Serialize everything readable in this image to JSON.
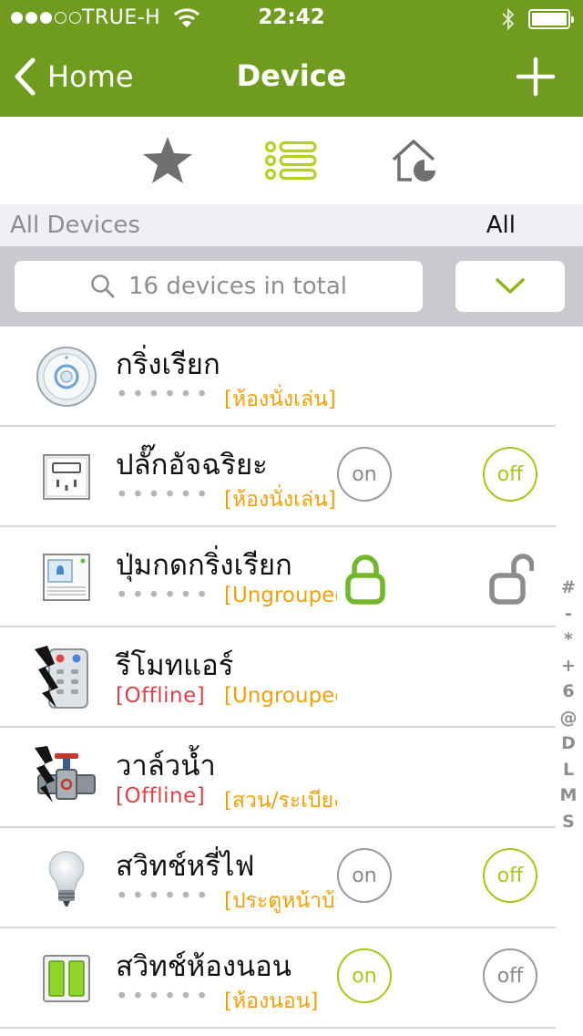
{
  "status_bar": {
    "carrier": "TRUE-H",
    "time": "22:42"
  },
  "nav": {
    "back_label": "Home",
    "title": "Device"
  },
  "tabs": [
    {
      "icon": "star-icon",
      "selected": false
    },
    {
      "icon": "list-icon",
      "selected": true
    },
    {
      "icon": "home-chart-icon",
      "selected": false
    }
  ],
  "section": {
    "title": "All Devices",
    "filter": "All"
  },
  "search": {
    "text": "16 devices  in total"
  },
  "devices": [
    {
      "name": "กริ่งเรียก",
      "status": "••••••",
      "room": "[ห้องนั่งเล่น]",
      "icon": "doorbell-icon"
    },
    {
      "name": "ปลั๊กอัจฉริยะ",
      "status": "••••••",
      "room": "[ห้องนั่งเล่น]",
      "icon": "smart-plug-icon",
      "on_label": "on",
      "off_label": "off"
    },
    {
      "name": "ปุ่มกดกริ่งเรียก",
      "status": "••••••",
      "room": "[Ungrouped]",
      "icon": "bell-button-icon"
    },
    {
      "name": "รีโมทแอร์",
      "status": "[Offline]",
      "room": "[Ungrouped]",
      "icon": "ac-remote-icon"
    },
    {
      "name": "วาล์วน้ำ",
      "status": "[Offline]",
      "room": "[สวน/ระเบียง]",
      "icon": "water-valve-icon"
    },
    {
      "name": "สวิทช์หรี่ไฟ",
      "status": "••••••",
      "room": "[ประตูหน้าบ้าน]",
      "icon": "light-bulb-icon",
      "on_label": "on",
      "off_label": "off"
    },
    {
      "name": "สวิทช์ห้องนอน",
      "status": "••••••",
      "room": "[ห้องนอน]",
      "icon": "wall-switch-icon",
      "on_label": "on",
      "off_label": "off"
    }
  ],
  "index_letters": [
    "#",
    "-",
    "*",
    "+",
    "6",
    "@",
    "D",
    "L",
    "M",
    "S"
  ],
  "colors": {
    "brand_green": "#6f9c1e",
    "accent_lime": "#a7c81a",
    "room_orange": "#f0a10a",
    "offline_red": "#d9434c"
  }
}
